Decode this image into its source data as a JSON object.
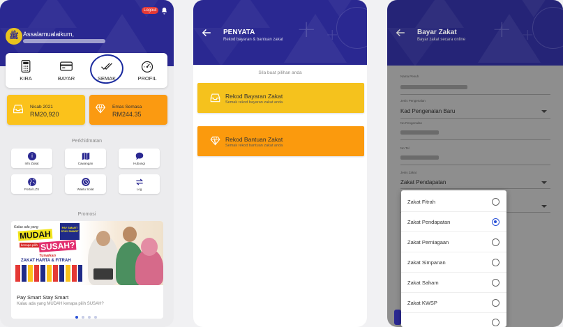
{
  "screen1": {
    "greeting": "Assalamualaikum,",
    "logout": "Logout",
    "quick": [
      {
        "label": "KIRA",
        "icon": "calculator-icon"
      },
      {
        "label": "BAYAR",
        "icon": "card-icon"
      },
      {
        "label": "SEMAK",
        "icon": "check-icon"
      },
      {
        "label": "PROFIL",
        "icon": "gauge-icon"
      }
    ],
    "nisab_label": "Nisab 2021",
    "nisab_value": "RM20,920",
    "emas_label": "Emas Semasa",
    "emas_value": "RM244.35",
    "services_title": "Perkhidmatan",
    "services": [
      "Info Zakat",
      "Cawangan",
      "Hubungi",
      "Portal LZS",
      "Waktu Solat",
      "Log"
    ],
    "promo_title": "Promosi",
    "promo_card_title": "Pay Smart Stay Smart",
    "promo_card_sub": "Kalau ada yang MUDAH kenapa pilih SUSAH?",
    "banner": {
      "kalau": "Kalau ada yang",
      "mudah": "MUDAH",
      "kenapa": "kenapa pilih",
      "susah": "SUSAH?",
      "tunaikan": "Tunaikan",
      "zakat": "ZAKAT HARTA & FITRAH",
      "badge": "PAY SMART STAY SMART"
    },
    "colors": {
      "header": "#2a2891",
      "nisab": "#fbc21b",
      "emas": "#fb9a11"
    }
  },
  "screen2": {
    "title": "PENYATA",
    "subtitle": "Rekod bayaran & bantuan zakat",
    "prompt": "Sila buat pilihan anda",
    "options": [
      {
        "title": "Rekod Bayaran Zakat",
        "sub": "Semak rekod bayaran zakat anda",
        "color": "#f5c21d"
      },
      {
        "title": "Rekod Bantuan Zakat",
        "sub": "Semak rekod bantuan zakat anda",
        "color": "#fb9a0d"
      }
    ]
  },
  "screen3": {
    "title": "Bayar Zakat",
    "subtitle": "Bayar zakat secara online",
    "fields": {
      "nama_label": "Nama Penuh",
      "jenis_pengenalan_label": "Jenis Pengenalan",
      "jenis_pengenalan_value": "Kad Pengenalan Baru",
      "no_pengenalan_label": "No Pengenalan",
      "no_tel_label": "No Tel",
      "jenis_zakat_label": "Jenis Zakat",
      "jenis_zakat_value": "Zakat Pendapatan"
    },
    "dropdown_options": [
      "Zakat Fitrah",
      "Zakat Pendapatan",
      "Zakat Perniagaan",
      "Zakat Simpanan",
      "Zakat Saham",
      "Zakat KWSP"
    ],
    "selected": "Zakat Pendapatan"
  }
}
